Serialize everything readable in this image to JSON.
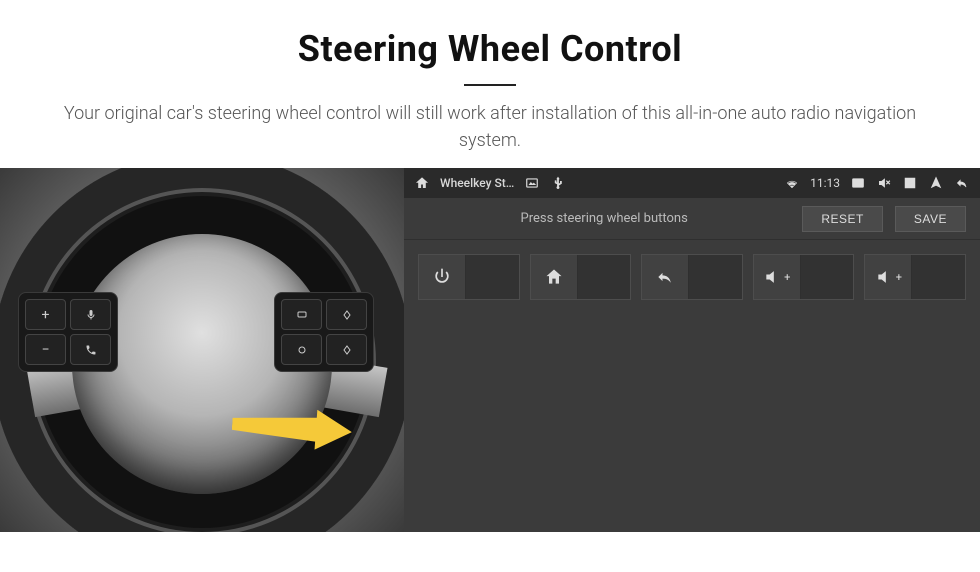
{
  "header": {
    "title": "Steering Wheel Control",
    "subtitle": "Your original car's steering wheel control will still work after installation of this all-in-one auto radio navigation system."
  },
  "wheel": {
    "left_pad": {
      "btn1": "+",
      "btn2": "mic",
      "btn3": "−",
      "btn4": "phone"
    },
    "right_pad": {
      "btn1": "mode",
      "btn2": "up-diamond",
      "btn3": "circle",
      "btn4": "down-diamond"
    }
  },
  "screen": {
    "status": {
      "app_title": "Wheelkey St…",
      "time": "11:13",
      "icons": [
        "home",
        "picture",
        "usb",
        "wifi",
        "cast",
        "mute",
        "close-window",
        "nav",
        "back"
      ]
    },
    "config": {
      "prompt": "Press steering wheel buttons",
      "reset_label": "RESET",
      "save_label": "SAVE"
    },
    "mappings": [
      {
        "name": "power",
        "glyph": "power"
      },
      {
        "name": "home",
        "glyph": "home"
      },
      {
        "name": "back",
        "glyph": "back"
      },
      {
        "name": "vol-up",
        "glyph": "volup",
        "label": "+"
      },
      {
        "name": "vol-up-2",
        "glyph": "volup",
        "label": "+"
      }
    ]
  }
}
